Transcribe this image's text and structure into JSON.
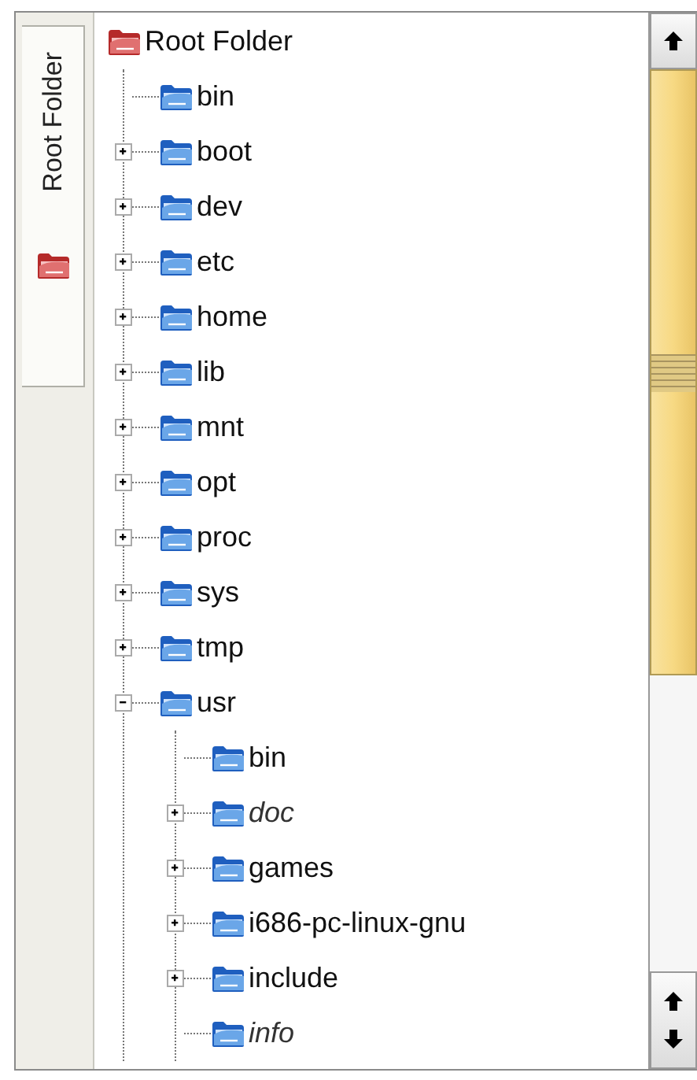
{
  "side_tab": {
    "label": "Root Folder",
    "selected": true
  },
  "tree": {
    "label": "Root Folder",
    "kind": "root",
    "children": [
      {
        "label": "bin",
        "kind": "folder"
      },
      {
        "label": "boot",
        "kind": "folder",
        "expanded": false
      },
      {
        "label": "dev",
        "kind": "folder",
        "expanded": false
      },
      {
        "label": "etc",
        "kind": "folder",
        "expanded": false
      },
      {
        "label": "home",
        "kind": "folder",
        "expanded": false
      },
      {
        "label": "lib",
        "kind": "folder",
        "expanded": false
      },
      {
        "label": "mnt",
        "kind": "folder",
        "expanded": false
      },
      {
        "label": "opt",
        "kind": "folder",
        "expanded": false
      },
      {
        "label": "proc",
        "kind": "folder",
        "expanded": false
      },
      {
        "label": "sys",
        "kind": "folder",
        "expanded": false
      },
      {
        "label": "tmp",
        "kind": "folder",
        "expanded": false
      },
      {
        "label": "usr",
        "kind": "folder",
        "expanded": true,
        "children": [
          {
            "label": "bin",
            "kind": "folder"
          },
          {
            "label": "doc",
            "kind": "link",
            "expanded": false
          },
          {
            "label": "games",
            "kind": "folder",
            "expanded": false
          },
          {
            "label": "i686-pc-linux-gnu",
            "kind": "folder",
            "expanded": false
          },
          {
            "label": "include",
            "kind": "folder",
            "expanded": false
          },
          {
            "label": "info",
            "kind": "link"
          }
        ]
      }
    ]
  }
}
